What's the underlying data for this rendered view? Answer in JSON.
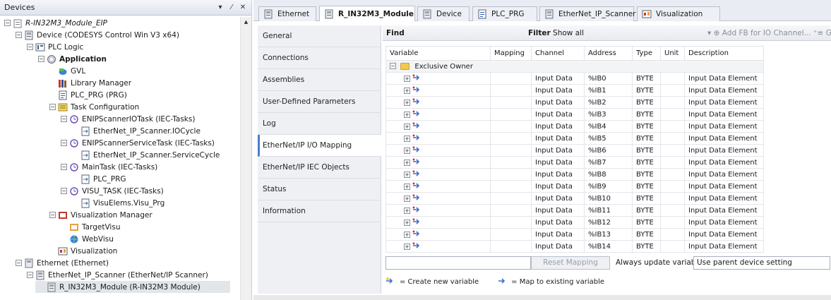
{
  "devices_panel": {
    "title": "Devices",
    "controls": [
      "▾",
      "⁄",
      "✕"
    ],
    "tree": [
      {
        "label": "R-IN32M3_Module_EIP",
        "indent": 0,
        "icon": "project-icon",
        "expander": "−",
        "style": "italic"
      },
      {
        "label": "Device (CODESYS Control Win V3 x64)",
        "indent": 1,
        "icon": "device-icon",
        "expander": "−"
      },
      {
        "label": "PLC Logic",
        "indent": 2,
        "icon": "plc-logic-icon",
        "expander": "−"
      },
      {
        "label": "Application",
        "indent": 3,
        "icon": "application-icon",
        "expander": "−",
        "style": "bold"
      },
      {
        "label": "GVL",
        "indent": 4,
        "icon": "gvl-icon"
      },
      {
        "label": "Library Manager",
        "indent": 4,
        "icon": "library-manager-icon"
      },
      {
        "label": "PLC_PRG (PRG)",
        "indent": 4,
        "icon": "pou-icon"
      },
      {
        "label": "Task Configuration",
        "indent": 4,
        "icon": "task-config-icon",
        "expander": "−"
      },
      {
        "label": "ENIPScannerIOTask (IEC-Tasks)",
        "indent": 5,
        "icon": "task-icon",
        "expander": "−"
      },
      {
        "label": "EtherNet_IP_Scanner.IOCycle",
        "indent": 6,
        "icon": "call-icon"
      },
      {
        "label": "ENIPScannerServiceTask (IEC-Tasks)",
        "indent": 5,
        "icon": "task-icon",
        "expander": "−"
      },
      {
        "label": "EtherNet_IP_Scanner.ServiceCycle",
        "indent": 6,
        "icon": "call-icon"
      },
      {
        "label": "MainTask (IEC-Tasks)",
        "indent": 5,
        "icon": "task-icon",
        "expander": "−"
      },
      {
        "label": "PLC_PRG",
        "indent": 6,
        "icon": "call-icon"
      },
      {
        "label": "VISU_TASK (IEC-Tasks)",
        "indent": 5,
        "icon": "task-icon",
        "expander": "−"
      },
      {
        "label": "VisuElems.Visu_Prg",
        "indent": 6,
        "icon": "call-icon"
      },
      {
        "label": "Visualization Manager",
        "indent": 4,
        "icon": "visu-manager-icon",
        "expander": "−"
      },
      {
        "label": "TargetVisu",
        "indent": 5,
        "icon": "target-visu-icon"
      },
      {
        "label": "WebVisu",
        "indent": 5,
        "icon": "web-visu-icon"
      },
      {
        "label": "Visualization",
        "indent": 4,
        "icon": "visualization-icon"
      },
      {
        "label": "Ethernet (Ethernet)",
        "indent": 1,
        "icon": "ethernet-icon",
        "expander": "−"
      },
      {
        "label": "EtherNet_IP_Scanner (EtherNet/IP Scanner)",
        "indent": 2,
        "icon": "device-icon",
        "expander": "−"
      },
      {
        "label": "R_IN32M3_Module (R-IN32M3 Module)",
        "indent": 3,
        "icon": "device-icon",
        "selected": true
      }
    ]
  },
  "editor_tabs": [
    {
      "label": "Ethernet",
      "icon": "device-icon"
    },
    {
      "label": "R_IN32M3_Module",
      "icon": "device-icon",
      "active": true,
      "close": "✕"
    },
    {
      "label": "Device",
      "icon": "device-icon"
    },
    {
      "label": "PLC_PRG",
      "icon": "pou-icon"
    },
    {
      "label": "EtherNet_IP_Scanner",
      "icon": "device-icon"
    },
    {
      "label": "Visualization",
      "icon": "visualization-icon"
    }
  ],
  "side_tabs": [
    {
      "label": "General"
    },
    {
      "label": "Connections"
    },
    {
      "label": "Assemblies"
    },
    {
      "label": "User-Defined Parameters"
    },
    {
      "label": "Log"
    },
    {
      "label": "EtherNet/IP I/O Mapping",
      "active": true
    },
    {
      "label": "EtherNet/IP IEC Objects"
    },
    {
      "label": "Status"
    },
    {
      "label": "Information"
    }
  ],
  "find_bar": {
    "find_label": "Find",
    "filter_label": "Filter",
    "filter_value": "Show all",
    "add_fb_label": "Add FB for IO Channel...",
    "goto_label": "Go"
  },
  "mapping_table": {
    "columns": [
      "Variable",
      "Mapping",
      "Channel",
      "Address",
      "Type",
      "Unit",
      "Description"
    ],
    "group_label": "Exclusive Owner",
    "rows": [
      {
        "channel": "Input Data",
        "address": "%IB0",
        "type": "BYTE",
        "description": "Input Data Element"
      },
      {
        "channel": "Input Data",
        "address": "%IB1",
        "type": "BYTE",
        "description": "Input Data Element"
      },
      {
        "channel": "Input Data",
        "address": "%IB2",
        "type": "BYTE",
        "description": "Input Data Element"
      },
      {
        "channel": "Input Data",
        "address": "%IB3",
        "type": "BYTE",
        "description": "Input Data Element"
      },
      {
        "channel": "Input Data",
        "address": "%IB4",
        "type": "BYTE",
        "description": "Input Data Element"
      },
      {
        "channel": "Input Data",
        "address": "%IB5",
        "type": "BYTE",
        "description": "Input Data Element"
      },
      {
        "channel": "Input Data",
        "address": "%IB6",
        "type": "BYTE",
        "description": "Input Data Element"
      },
      {
        "channel": "Input Data",
        "address": "%IB7",
        "type": "BYTE",
        "description": "Input Data Element"
      },
      {
        "channel": "Input Data",
        "address": "%IB8",
        "type": "BYTE",
        "description": "Input Data Element"
      },
      {
        "channel": "Input Data",
        "address": "%IB9",
        "type": "BYTE",
        "description": "Input Data Element"
      },
      {
        "channel": "Input Data",
        "address": "%IB10",
        "type": "BYTE",
        "description": "Input Data Element"
      },
      {
        "channel": "Input Data",
        "address": "%IB11",
        "type": "BYTE",
        "description": "Input Data Element"
      },
      {
        "channel": "Input Data",
        "address": "%IB12",
        "type": "BYTE",
        "description": "Input Data Element"
      },
      {
        "channel": "Input Data",
        "address": "%IB13",
        "type": "BYTE",
        "description": "Input Data Element"
      },
      {
        "channel": "Input Data",
        "address": "%IB14",
        "type": "BYTE",
        "description": "Input Data Element"
      }
    ]
  },
  "bottom": {
    "reset_mapping_label": "Reset Mapping",
    "always_update_label": "Always update variables",
    "update_setting_value": "Use parent device setting",
    "legend_create": "= Create new variable",
    "legend_map": "= Map to existing variable"
  },
  "colors": {
    "active_tab_accent": "#4a7fcc",
    "folder": "#f2c94c",
    "mapping_arrow": "#3b6fd1",
    "mapping_arrow_red": "#d23c2a"
  }
}
